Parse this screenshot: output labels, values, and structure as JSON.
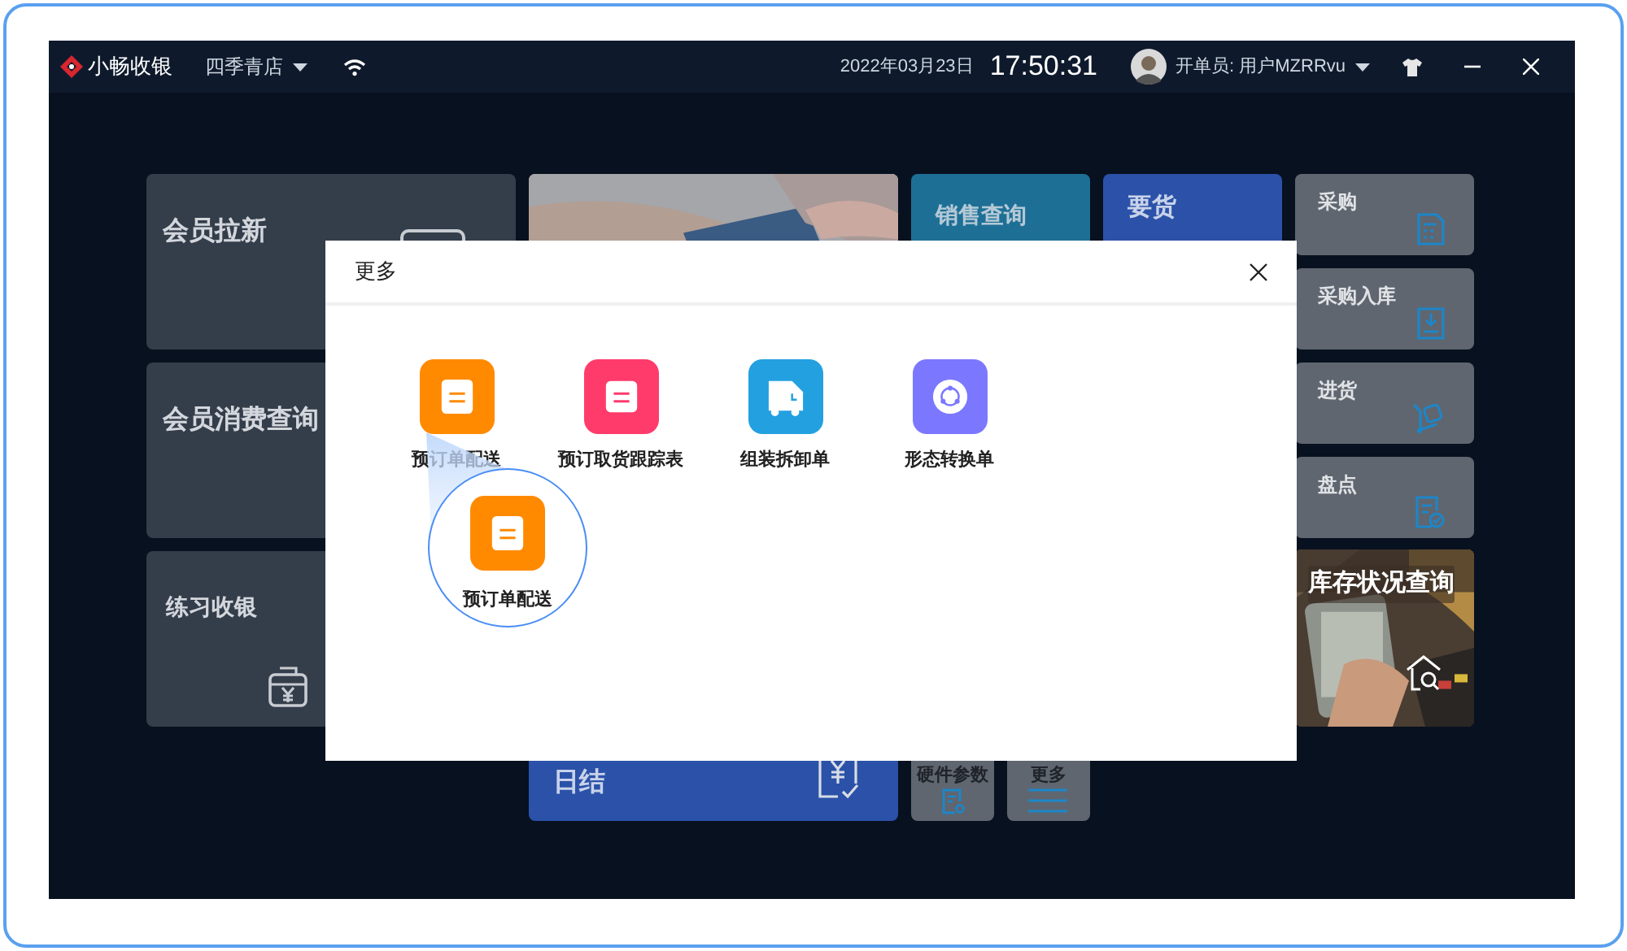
{
  "window": {
    "app_name": "小畅收银",
    "store": "四季青店",
    "date": "2022年03月23日",
    "time": "17:50:31",
    "operator": "开单员: 用户MZRRvu"
  },
  "tiles": [
    {
      "label": "会员拉新",
      "kind": "dark"
    },
    {
      "kind": "picture"
    },
    {
      "label": "销售查询",
      "kind": "teal"
    },
    {
      "label": "要货",
      "kind": "blue"
    },
    {
      "label": "采购",
      "kind": "gray"
    },
    {
      "label": "采购入库",
      "kind": "gray"
    },
    {
      "label": "进货",
      "kind": "gray"
    },
    {
      "label": "盘点",
      "kind": "gray"
    },
    {
      "label": "会员消费查询",
      "kind": "dark"
    },
    {
      "label": "练习收银",
      "kind": "dark"
    },
    {
      "label": "库存状况查询"
    },
    {
      "label": "日结",
      "kind": "blue"
    },
    {
      "label": "硬件参数",
      "kind": "small"
    },
    {
      "label": "更多",
      "kind": "small"
    }
  ],
  "dialog": {
    "title": "更多",
    "items": [
      {
        "label": "预订单配送",
        "color": "#ff8a00"
      },
      {
        "label": "预订取货跟踪表",
        "color": "#ff3b6b"
      },
      {
        "label": "组装拆卸单",
        "color": "#23a0e0"
      },
      {
        "label": "形态转换单",
        "color": "#7b78ff"
      }
    ],
    "callout": {
      "label": "预订单配送",
      "color": "#ff8a00"
    }
  }
}
